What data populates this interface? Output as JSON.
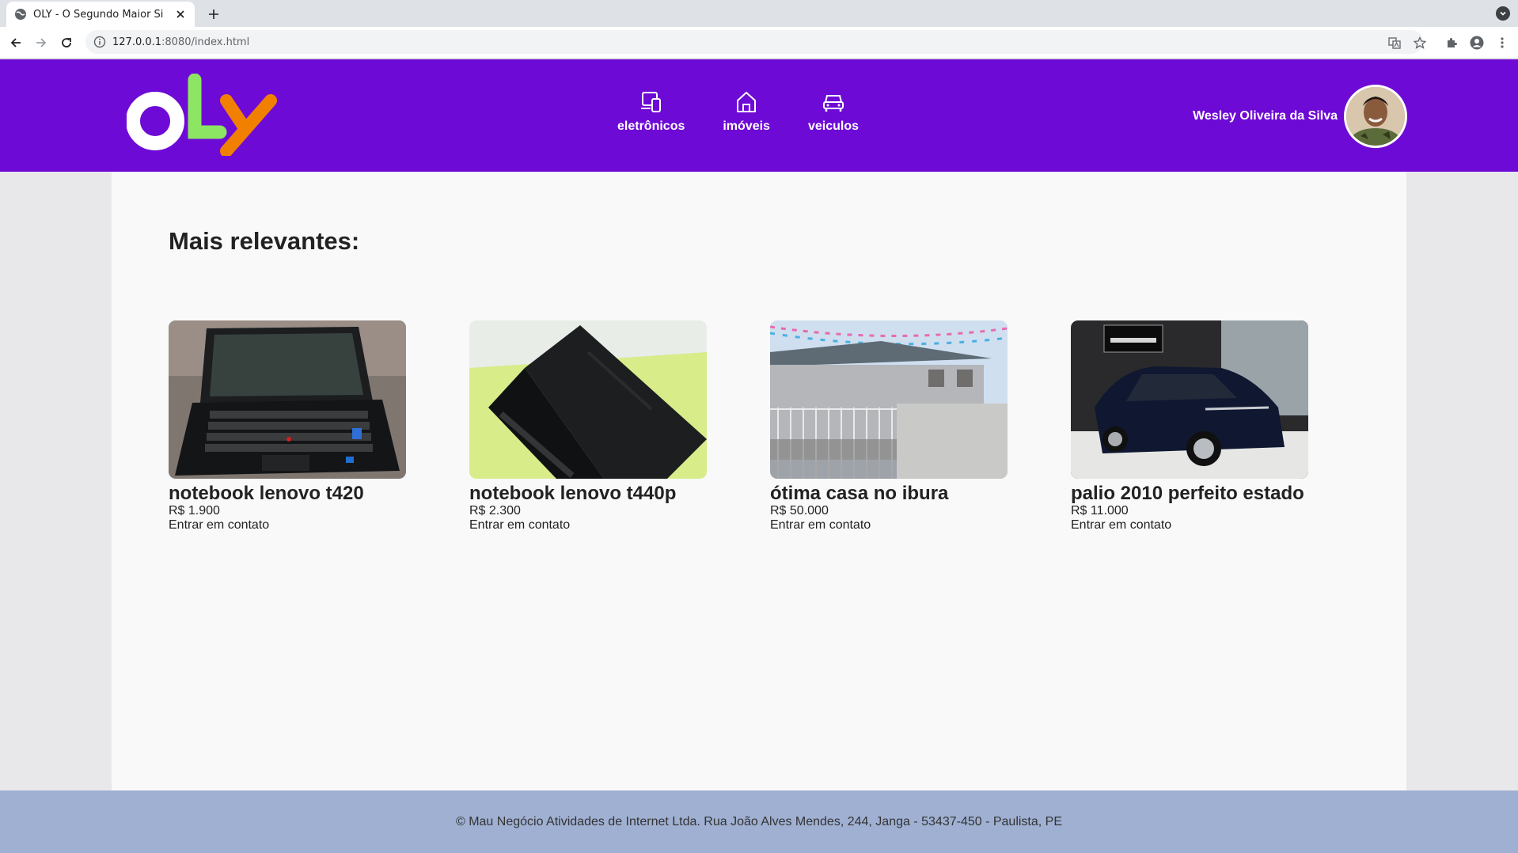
{
  "browser": {
    "tab_title": "OLY - O Segundo Maior Si",
    "url_host": "127.0.0.1",
    "url_rest": ":8080/index.html"
  },
  "header": {
    "logo_text": "OLY",
    "nav": [
      {
        "label": "eletrônicos",
        "icon": "devices-icon"
      },
      {
        "label": "imóveis",
        "icon": "home-icon"
      },
      {
        "label": "veiculos",
        "icon": "car-icon"
      }
    ],
    "user_name": "Wesley Oliveira da Silva"
  },
  "main": {
    "section_title": "Mais relevantes:",
    "products": [
      {
        "title": "notebook lenovo t420",
        "price": "R$ 1.900",
        "contact": "Entrar em contato"
      },
      {
        "title": "notebook lenovo t440p",
        "price": "R$ 2.300",
        "contact": "Entrar em contato"
      },
      {
        "title": "ótima casa no ibura",
        "price": "R$ 50.000",
        "contact": "Entrar em contato"
      },
      {
        "title": "palio 2010 perfeito estado",
        "price": "R$ 11.000",
        "contact": "Entrar em contato"
      }
    ]
  },
  "footer": {
    "text": "© Mau Negócio Atividades de Internet Ltda. Rua João Alves Mendes, 244, Janga - 53437-450 - Paulista, PE"
  },
  "colors": {
    "brand_purple": "#6e0ad6",
    "logo_green": "#8ce563",
    "logo_orange": "#f28000",
    "footer_bg": "#9fb0d2"
  }
}
